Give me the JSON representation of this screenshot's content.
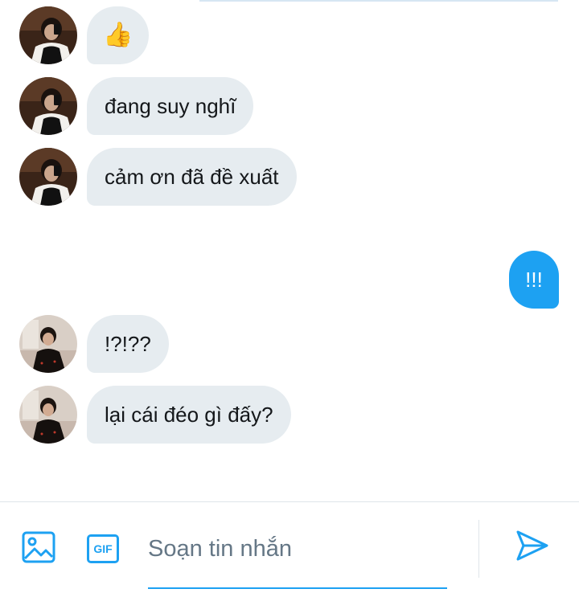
{
  "conversation": {
    "messages": [
      {
        "direction": "received",
        "sender_avatar": "avatar-a",
        "text": "👍"
      },
      {
        "direction": "received",
        "sender_avatar": "avatar-a",
        "text": "đang suy nghĩ"
      },
      {
        "direction": "received",
        "sender_avatar": "avatar-a",
        "text": "cảm ơn đã đề xuất"
      },
      {
        "direction": "sent",
        "text": "!!!"
      },
      {
        "direction": "received",
        "sender_avatar": "avatar-b",
        "text": "!?!??"
      },
      {
        "direction": "received",
        "sender_avatar": "avatar-b",
        "text": "lại cái đéo gì đấy?"
      }
    ]
  },
  "composer": {
    "placeholder": "Soạn tin nhắn",
    "value": "",
    "media_icon": "image-icon",
    "gif_icon": "gif-icon",
    "gif_label": "GIF",
    "send_icon": "send-icon"
  },
  "colors": {
    "accent": "#1da1f2",
    "received_bubble": "#e6ecf0",
    "sent_text": "#ffffff",
    "placeholder": "#657786"
  }
}
